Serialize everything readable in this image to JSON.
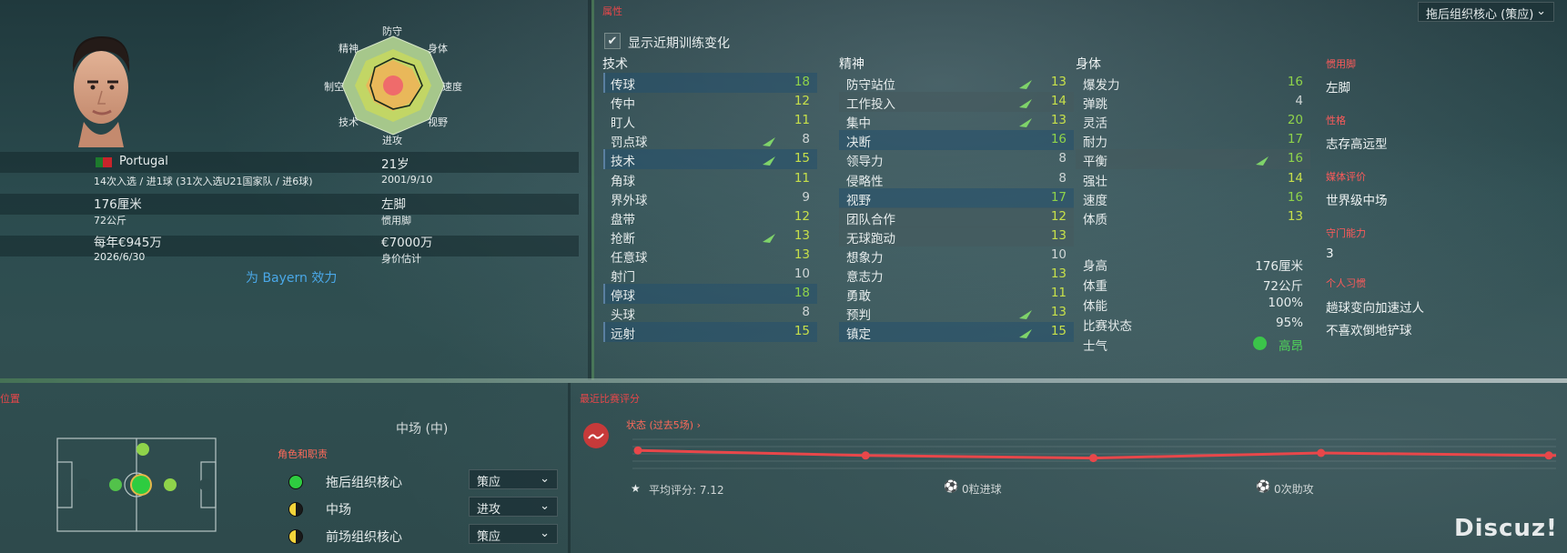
{
  "header": {
    "role_dropdown": "拖后组织核心 (策应)"
  },
  "profile": {
    "radar_labels": {
      "def": "防守",
      "phys": "身体",
      "speed": "速度",
      "vision": "视野",
      "attack": "进攻",
      "tech": "技术",
      "aerial": "制空",
      "mental": "精神"
    },
    "nationality": "Portugal",
    "caps": "14次入选 / 进1球 (31次入选U21国家队 / 进6球)",
    "age": "21岁",
    "dob": "2001/9/10",
    "height": "176厘米",
    "weight": "72公斤",
    "foot": "左脚",
    "foot_label": "惯用脚",
    "wage": "每年€945万",
    "contract": "2026/6/30",
    "value": "€7000万",
    "value_label": "身价估计",
    "club": "为 Bayern 效力"
  },
  "attributes": {
    "section_title": "属性",
    "show_training": "显示近期训练变化",
    "tech_head": "技术",
    "mental_head": "精神",
    "phys_head": "身体",
    "technical": [
      {
        "name": "传球",
        "value": "18"
      },
      {
        "name": "传中",
        "value": "12"
      },
      {
        "name": "盯人",
        "value": "11"
      },
      {
        "name": "罚点球",
        "value": "8"
      },
      {
        "name": "技术",
        "value": "15"
      },
      {
        "name": "角球",
        "value": "11"
      },
      {
        "name": "界外球",
        "value": "9"
      },
      {
        "name": "盘带",
        "value": "12"
      },
      {
        "name": "抢断",
        "value": "13"
      },
      {
        "name": "任意球",
        "value": "13"
      },
      {
        "name": "射门",
        "value": "10"
      },
      {
        "name": "停球",
        "value": "18"
      },
      {
        "name": "头球",
        "value": "8"
      },
      {
        "name": "远射",
        "value": "15"
      }
    ],
    "mental": [
      {
        "name": "防守站位",
        "value": "13"
      },
      {
        "name": "工作投入",
        "value": "14"
      },
      {
        "name": "集中",
        "value": "13"
      },
      {
        "name": "决断",
        "value": "16"
      },
      {
        "name": "领导力",
        "value": "8"
      },
      {
        "name": "侵略性",
        "value": "8"
      },
      {
        "name": "视野",
        "value": "17"
      },
      {
        "name": "团队合作",
        "value": "12"
      },
      {
        "name": "无球跑动",
        "value": "13"
      },
      {
        "name": "想象力",
        "value": "10"
      },
      {
        "name": "意志力",
        "value": "13"
      },
      {
        "name": "勇敢",
        "value": "11"
      },
      {
        "name": "预判",
        "value": "13"
      },
      {
        "name": "镇定",
        "value": "15"
      }
    ],
    "physical": [
      {
        "name": "爆发力",
        "value": "16"
      },
      {
        "name": "弹跳",
        "value": "4"
      },
      {
        "name": "灵活",
        "value": "20"
      },
      {
        "name": "耐力",
        "value": "17"
      },
      {
        "name": "平衡",
        "value": "16"
      },
      {
        "name": "强壮",
        "value": "14"
      },
      {
        "name": "速度",
        "value": "16"
      },
      {
        "name": "体质",
        "value": "13"
      }
    ],
    "extra": [
      {
        "name": "身高",
        "value": "176厘米"
      },
      {
        "name": "体重",
        "value": "72公斤"
      },
      {
        "name": "体能",
        "value": "100%"
      },
      {
        "name": "比赛状态",
        "value": "95%"
      },
      {
        "name": "士气",
        "value": "高昂"
      }
    ]
  },
  "sidebar": {
    "foot_label": "惯用脚",
    "foot_value": "左脚",
    "personality_label": "性格",
    "personality_value": "志存高远型",
    "media_label": "媒体评价",
    "media_value": "世界级中场",
    "gk_label": "守门能力",
    "gk_value": "3",
    "habits_label": "个人习惯",
    "habit1": "趟球变向加速过人",
    "habit2": "不喜欢倒地铲球"
  },
  "position": {
    "section_title": "位置",
    "current": "中场 (中)",
    "roles_title": "角色和职责",
    "roles": [
      {
        "name": "拖后组织核心",
        "duty": "策应"
      },
      {
        "name": "中场",
        "duty": "进攻"
      },
      {
        "name": "前场组织核心",
        "duty": "策应"
      }
    ]
  },
  "form": {
    "section_title": "最近比赛评分",
    "link": "状态 (过去5场) ›",
    "avg": "平均评分: 7.12",
    "goals": "0粒进球",
    "assists": "0次助攻",
    "ratings": [
      7.2,
      7.1,
      7.05,
      7.15,
      7.1
    ],
    "line_color": "#e8474a"
  },
  "watermark": "Discuz!"
}
